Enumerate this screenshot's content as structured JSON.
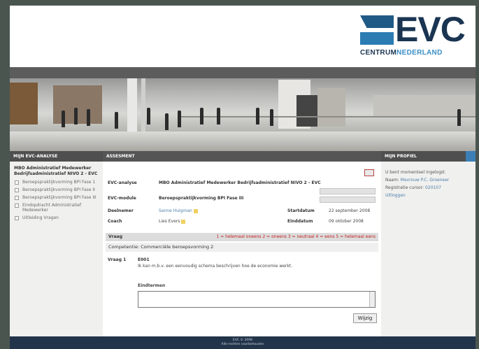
{
  "brand": {
    "logo_main": "EVC",
    "logo_sub_a": "CENTRUM",
    "logo_sub_b": "NEDERLAND",
    "colors": {
      "navy": "#1a3552",
      "blue": "#3b8ec6"
    }
  },
  "left": {
    "header": "MIJN EVC-ANALYSE",
    "title": "MBO Administratief Medewerker Bedrijfsadministratief NIVO 2 - EVC",
    "items": [
      "Beroepspraktijkvorming BPI Fase 1",
      "Beroepspraktijkvorming BPI Fase II",
      "Beroepspraktijkvorming BPI Fase III",
      "Eindopdracht Administratief Medewerker",
      "Uitleiding Vragen"
    ]
  },
  "main": {
    "header": "ASSESMENT",
    "evc_label": "EVC-analyse",
    "evc_value": "MBO Administratief Medewerker Bedrijfsadministratief NIVO 2 - EVC",
    "module_label": "EVC-module",
    "module_value": "Beroepspraktijkvorming BPI Fase III",
    "deelnemer_label": "Deelnemer",
    "deelnemer_value": "Sanne Huigman",
    "coach_label": "Coach",
    "coach_value": "Lies Evers",
    "start_label": "Startdatum",
    "start_value": "22 september 2008",
    "eind_label": "Einddatum",
    "eind_value": "09 oktober 2008",
    "vraag_label": "Vraag",
    "scale": "1 = helemaal oneens   2 = oneens   3 = neutraal   4 = eens   5 = helemaal eens",
    "competentie": "Competentie: Commerciële beroepsvorming 2",
    "q_num": "Vraag 1",
    "q_code": "E001",
    "q_text": "Ik kan m.b.v. een eenvoudig schema beschrijven hoe de economie werkt.",
    "answer_label": "Eindtermen",
    "submit": "Wijzig"
  },
  "right": {
    "header": "MIJN PROFIEL",
    "lines": [
      {
        "text": "U bent momenteel ingelogd:",
        "link": ""
      },
      {
        "text": "Naam:",
        "link": "Mevrouw P.C. Groeneer"
      },
      {
        "text": "Registratie cursor:",
        "link": "020107"
      },
      {
        "text": "",
        "link": "Uitloggen"
      }
    ]
  },
  "footer": {
    "line1": "EVC © 2008",
    "line2": "Alle rechten voorbehouden"
  }
}
